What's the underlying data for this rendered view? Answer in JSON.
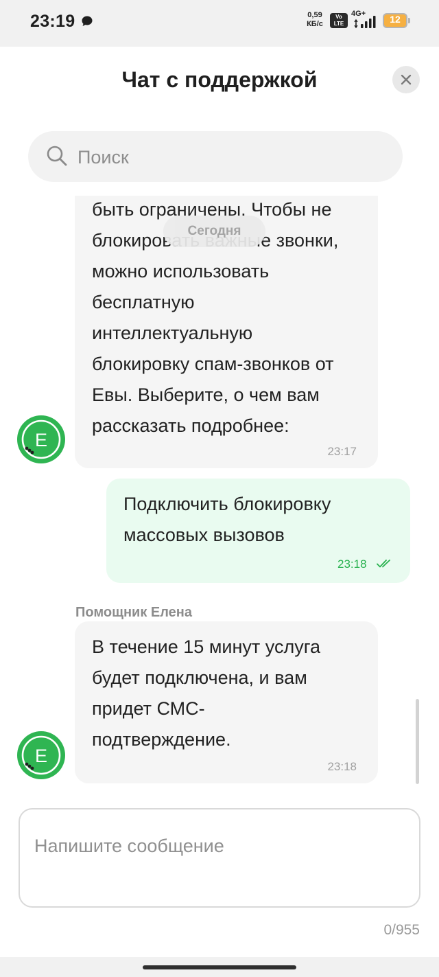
{
  "status_bar": {
    "time": "23:19",
    "speed_value": "0,59",
    "speed_unit": "КБ/с",
    "volte_line1": "Vo",
    "volte_line2": "LTE",
    "network": "4G+",
    "battery": "12",
    "battery_color": "#f6b042",
    "icons": [
      "message-icon",
      "signal-icon",
      "battery-icon"
    ]
  },
  "header": {
    "title": "Чат с поддержкой",
    "close_icon": "close-icon"
  },
  "search": {
    "placeholder": "Поиск",
    "value": "",
    "icon": "search-icon"
  },
  "chat": {
    "date_separator": "Сегодня",
    "messages": [
      {
        "direction": "incoming",
        "lines": [
          "быть ограничены. Чтобы не",
          "блокировать важные звонки,",
          "можно использовать",
          "бесплатную",
          "интеллектуальную",
          "блокировку спам-звонков от",
          "Евы. Выберите, о чем вам",
          "рассказать подробнее:"
        ],
        "time": "23:17"
      },
      {
        "direction": "outgoing",
        "lines": [
          "Подключить блокировку",
          "массовых вызовов"
        ],
        "time": "23:18",
        "status_icon": "double-check-icon"
      },
      {
        "direction": "incoming",
        "sender": "Помощник Елена",
        "lines": [
          "В течение 15 минут услуга",
          "будет подключена, и вам",
          "придет СМС-",
          "подтверждение."
        ],
        "time": "23:18"
      }
    ],
    "avatar_letter": "E",
    "accent_color": "#2fb552"
  },
  "composer": {
    "placeholder": "Напишите сообщение",
    "value": "",
    "counter": "0/955"
  }
}
